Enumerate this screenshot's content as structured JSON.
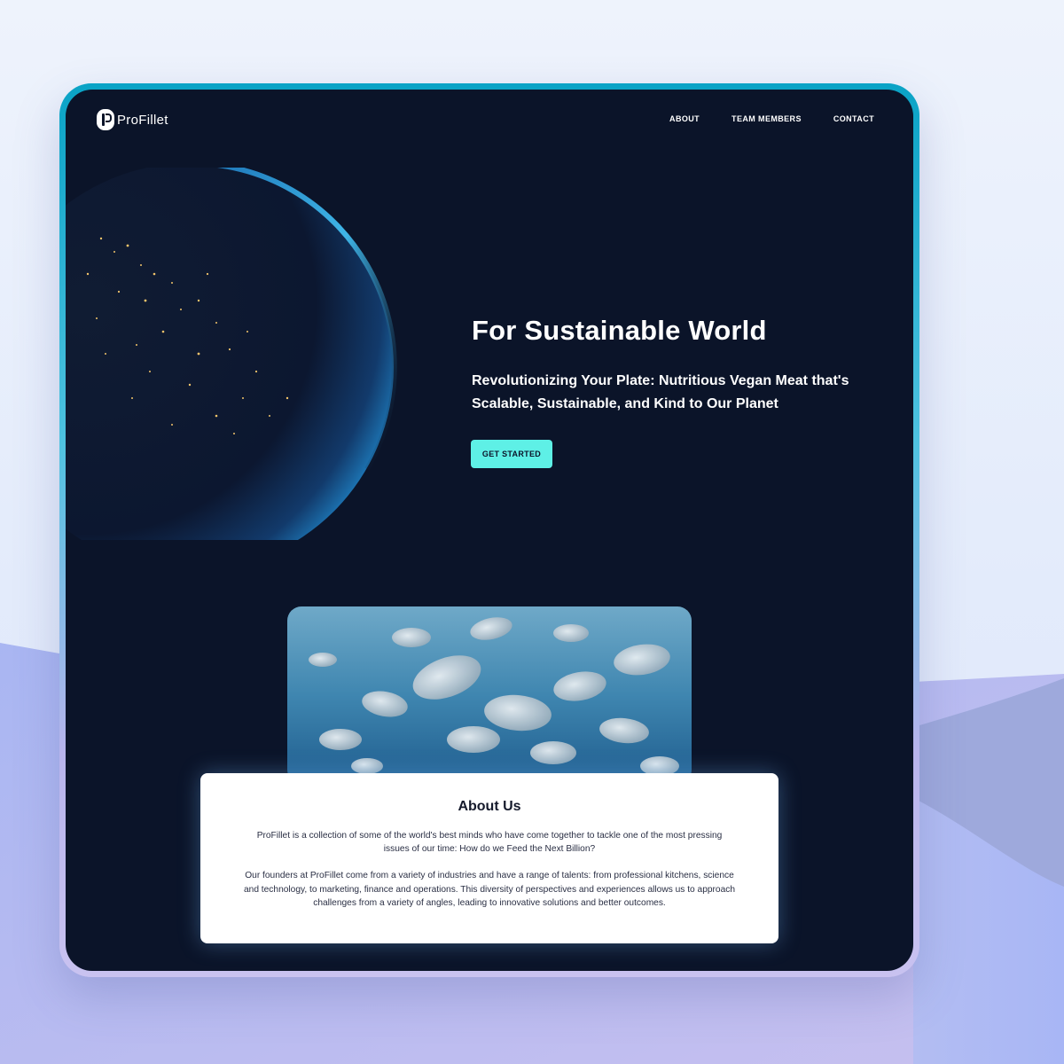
{
  "brand": {
    "name": "ProFillet"
  },
  "nav": {
    "items": [
      "ABOUT",
      "TEAM MEMBERS",
      "CONTACT"
    ]
  },
  "hero": {
    "title": "For Sustainable World",
    "subtitle": "Revolutionizing Your Plate: Nutritious Vegan Meat that's Scalable, Sustainable, and Kind to Our Planet",
    "cta_label": "GET STARTED"
  },
  "about": {
    "heading": "About Us",
    "paragraphs": [
      "ProFillet is a collection of some of the world's best minds who have come together to tackle one of the most pressing issues of our time: How do we Feed the Next Billion?",
      "Our founders at ProFillet come from a variety of industries and have a range of talents: from professional kitchens, science and technology, to marketing, finance and operations. This diversity of perspectives and experiences allows us to approach challenges from a variety of angles, leading to innovative solutions and better outcomes."
    ]
  },
  "colors": {
    "page_background": "#0b1429",
    "accent": "#5ef0e6",
    "frame_border": "#0aa3c6",
    "card_background": "#ffffff"
  },
  "icons": [
    "logo-icon"
  ]
}
